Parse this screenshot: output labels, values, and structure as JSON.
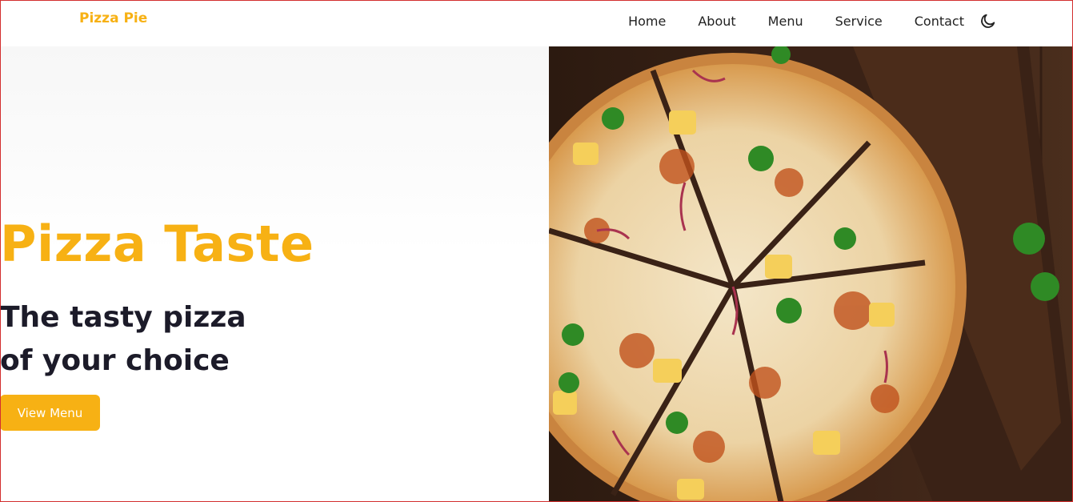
{
  "header": {
    "brand": "Pizza Pie",
    "nav": [
      {
        "label": "Home"
      },
      {
        "label": "About"
      },
      {
        "label": "Menu"
      },
      {
        "label": "Service"
      },
      {
        "label": "Contact"
      }
    ],
    "theme_toggle_icon": "moon-icon"
  },
  "hero": {
    "title": "Pizza Taste",
    "subtitle": "The tasty pizza of your choice",
    "cta_label": "View Menu",
    "image_subject": "pizza-image"
  },
  "colors": {
    "accent": "#f7b114",
    "heading": "#1c1b29",
    "nav_text": "#222222",
    "background": "#ffffff"
  }
}
